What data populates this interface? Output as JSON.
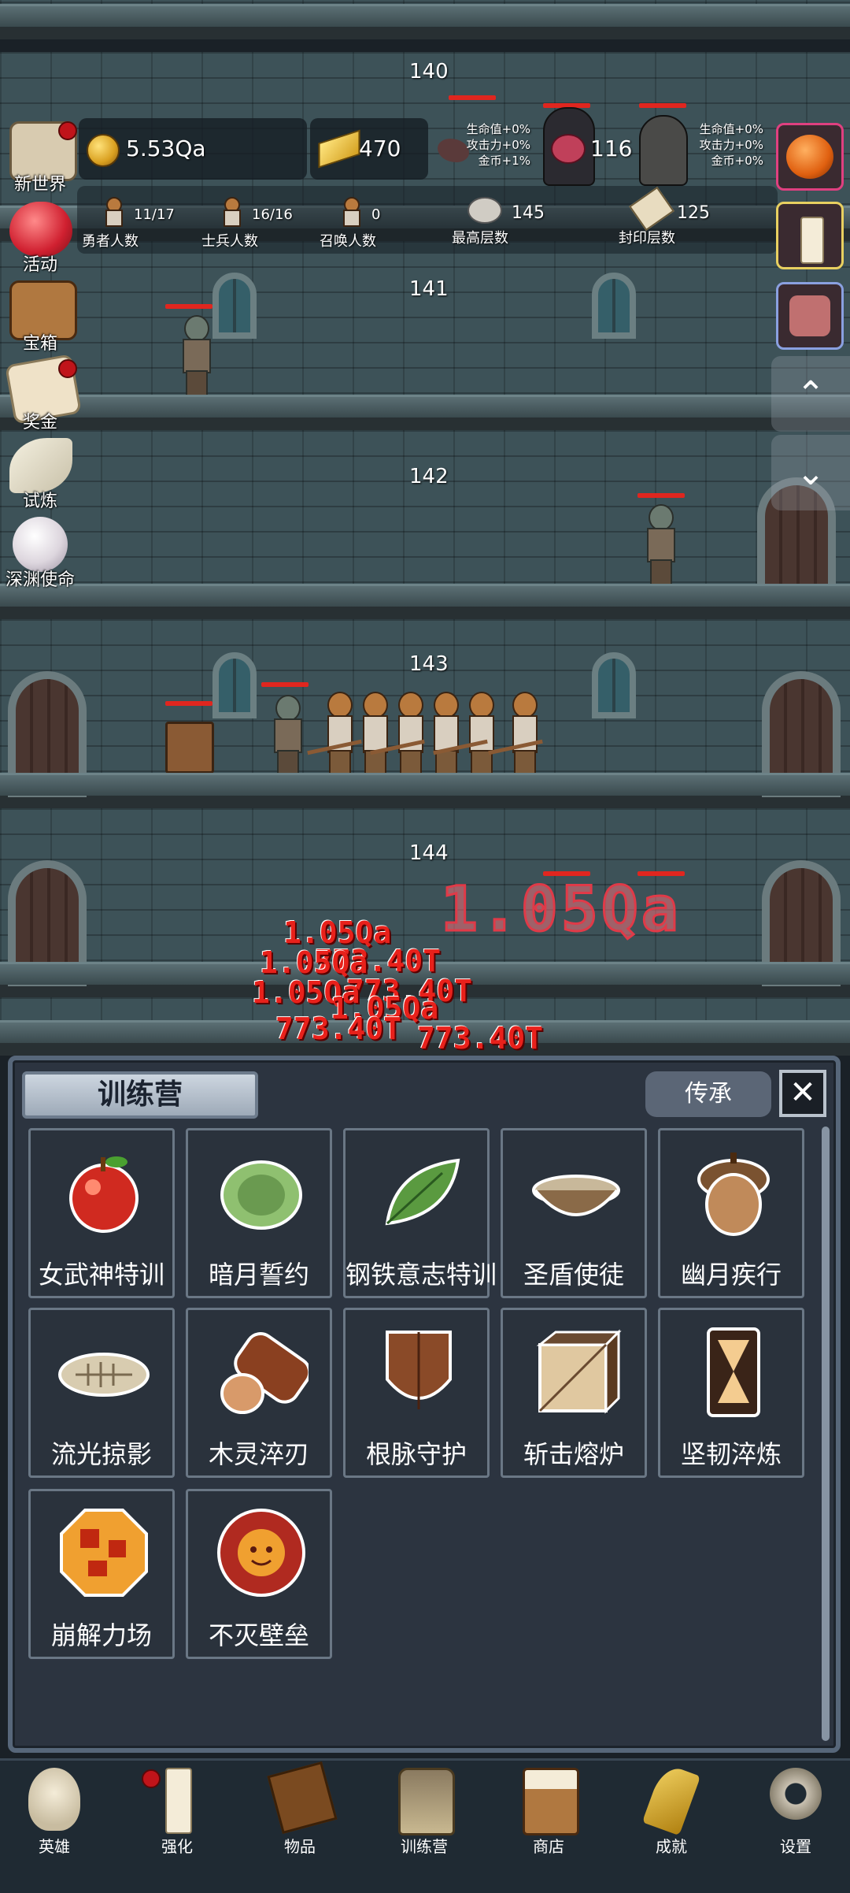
{
  "floors": [
    {
      "number": "140"
    },
    {
      "number": "141"
    },
    {
      "number": "142"
    },
    {
      "number": "143"
    },
    {
      "number": "144"
    }
  ],
  "hud": {
    "gold": "5.53Qa",
    "gold_bars": "470",
    "meat": "116",
    "left_bonus": {
      "hp": "生命值+0%",
      "atk": "攻击力+0%",
      "coin": "金币+1%"
    },
    "right_bonus": {
      "hp": "生命值+0%",
      "atk": "攻击力+0%",
      "coin": "金币+0%"
    },
    "hero_count": {
      "value": "11/17",
      "label": "勇者人数"
    },
    "soldier_count": {
      "value": "16/16",
      "label": "士兵人数"
    },
    "summon_count": {
      "value": "0",
      "label": "召唤人数"
    },
    "max_floor": {
      "value": "145",
      "label": "最高层数"
    },
    "sealed_floor": {
      "value": "125",
      "label": "封印层数"
    }
  },
  "side_menu": [
    {
      "label": "新世界",
      "icon": "scroll-map-icon",
      "badge": true
    },
    {
      "label": "活动",
      "icon": "heart-icon",
      "badge": false
    },
    {
      "label": "宝箱",
      "icon": "chest-icon",
      "badge": false
    },
    {
      "label": "奖金",
      "icon": "envelope-icon",
      "badge": true
    },
    {
      "label": "试炼",
      "icon": "feather-icon",
      "badge": false
    },
    {
      "label": "深渊使命",
      "icon": "pearl-icon",
      "badge": false
    }
  ],
  "right_menu": [
    {
      "icon": "pumpkin-icon"
    },
    {
      "icon": "candle-icon"
    },
    {
      "icon": "hero-portrait-icon"
    }
  ],
  "damage_numbers": {
    "small": [
      "1.05Qa",
      "1.05Qa",
      "1.05Qa",
      "1.05Qa",
      "773.40T",
      "773.40T",
      "773.40T",
      "773.40T"
    ],
    "big": "1.05Qa"
  },
  "panel": {
    "title": "训练营",
    "legacy_button": "传承",
    "close_icon": "close-icon",
    "items": [
      {
        "name": "女武神特训",
        "icon": "apple-icon"
      },
      {
        "name": "暗月誓约",
        "icon": "cabbage-icon"
      },
      {
        "name": "钢铁意志特训",
        "icon": "leaf-icon"
      },
      {
        "name": "圣盾使徒",
        "icon": "porridge-bowl-icon"
      },
      {
        "name": "幽月疾行",
        "icon": "acorn-icon"
      },
      {
        "name": "流光掠影",
        "icon": "fish-fossil-icon"
      },
      {
        "name": "木灵淬刃",
        "icon": "log-icon"
      },
      {
        "name": "根脉守护",
        "icon": "wooden-shield-icon"
      },
      {
        "name": "斩击熔炉",
        "icon": "block-icon"
      },
      {
        "name": "坚韧淬炼",
        "icon": "tower-shield-icon"
      },
      {
        "name": "崩解力场",
        "icon": "lava-orb-icon"
      },
      {
        "name": "不灭壁垒",
        "icon": "sun-orb-icon"
      }
    ]
  },
  "bottom_nav": [
    {
      "label": "英雄",
      "icon": "skull-icon",
      "badge": false
    },
    {
      "label": "强化",
      "icon": "candle-icon",
      "badge": true
    },
    {
      "label": "物品",
      "icon": "book-icon",
      "badge": false
    },
    {
      "label": "训练营",
      "icon": "lantern-icon",
      "badge": false
    },
    {
      "label": "商店",
      "icon": "beer-mug-icon",
      "badge": false
    },
    {
      "label": "成就",
      "icon": "key-icon",
      "badge": false
    },
    {
      "label": "设置",
      "icon": "gear-icon",
      "badge": false
    }
  ]
}
